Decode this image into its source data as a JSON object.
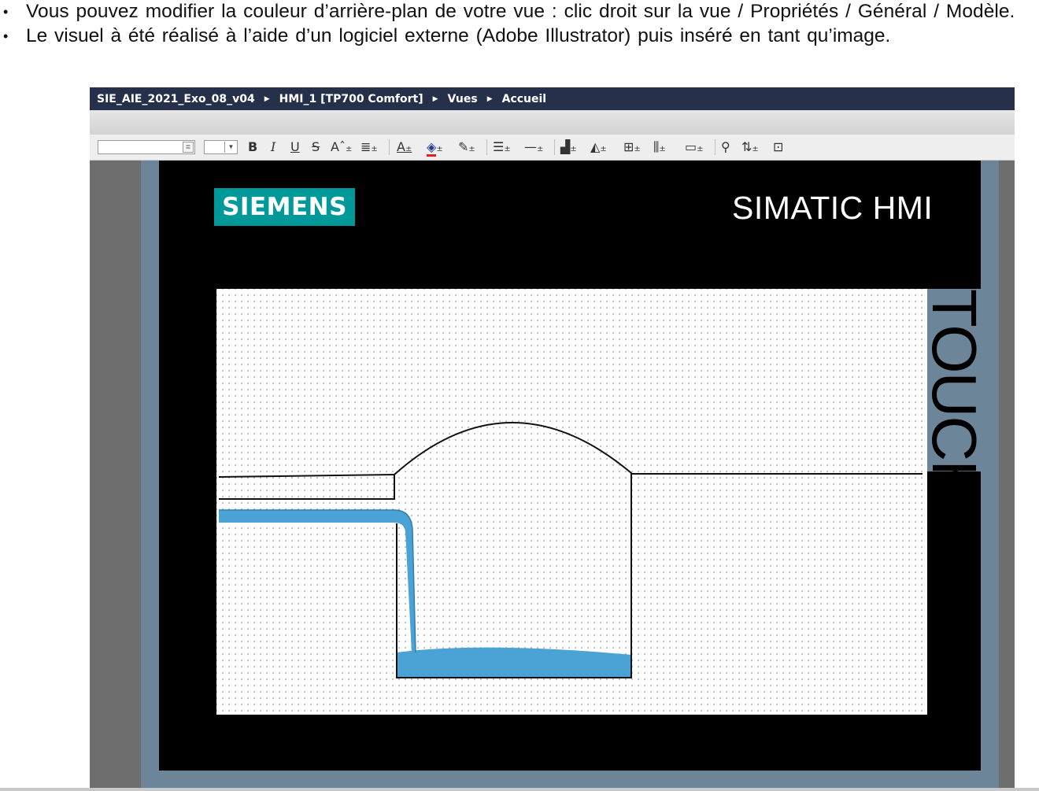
{
  "notes": {
    "line1": "Vous pouvez modifier la couleur d’arrière-plan de votre vue : clic droit sur la vue / Propriétés / Général / Modèle.",
    "line2": "Le visuel à été réalisé à l’aide d’un logiciel externe (Adobe Illustrator) puis inséré en tant qu’image.",
    "bullet": "•"
  },
  "breadcrumb": [
    "SIE_AIE_2021_Exo_08_v04",
    "HMI_1 [TP700 Comfort]",
    "Vues",
    "Accueil"
  ],
  "breadcrumb_separator": "▶",
  "toolbar": {
    "font_name": "",
    "font_size": "",
    "icons": [
      "bold-icon",
      "italic-icon",
      "underline-icon",
      "strikethrough-icon",
      "text-size-icon",
      "text-align-icon",
      "font-color-icon",
      "fill-color-icon",
      "line-color-icon",
      "line-style-icon",
      "line-width-icon",
      "arrange-icon",
      "rotate-icon",
      "align-icon",
      "distribute-icon",
      "same-size-icon",
      "format-painter-icon",
      "tab-order-icon",
      "zoom-icon"
    ]
  },
  "device": {
    "brand": "SIEMENS",
    "title": "SIMATIC HMI",
    "side_label": "TOUCH"
  },
  "colors": {
    "brand": "#009999",
    "title_bar": "#27304a",
    "frame": "#6d8599",
    "water": "#4aa3d4"
  }
}
